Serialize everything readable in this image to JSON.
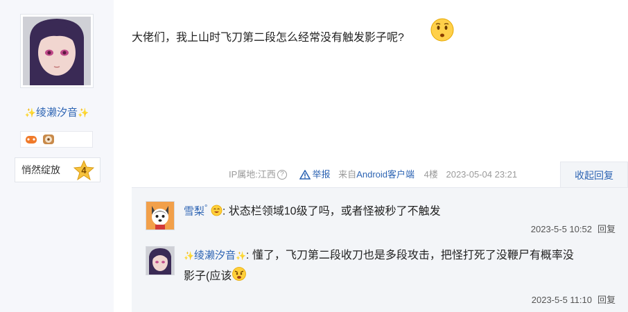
{
  "user": {
    "name": "绫濑汐音",
    "sparkle_left": "✨",
    "sparkle_right": "✨",
    "level_name": "悄然绽放",
    "level_number": "4"
  },
  "post": {
    "content": "大佬们，我上山时飞刀第二段怎么经常没有触发影子呢?",
    "meta": {
      "ip_label": "IP属地:江西",
      "help_icon": "?",
      "report_label": "举报",
      "source_prefix": "来自",
      "source_link": "Android客户端",
      "floor": "4楼",
      "timestamp": "2023-05-04 23:21"
    },
    "collapse_label": "收起回复"
  },
  "replies": [
    {
      "author": "雪梨",
      "author_suffix": "°",
      "text": ": 状态栏领域10级了吗，或者怪被秒了不触发",
      "time": "2023-5-5 10:52",
      "reply_label": "回复"
    },
    {
      "author": "绫濑汐音",
      "author_sparkle_left": "✨",
      "author_sparkle_right": "✨",
      "text_line1": ": 懂了，飞刀第二段收刀也是多段攻击，把怪打死了没鞭尸有概率没",
      "text_line2": "影子(应该",
      "time": "2023-5-5 11:10",
      "reply_label": "回复"
    }
  ],
  "colors": {
    "link_blue": "#2d64b3",
    "meta_gray": "#9a9a9a",
    "reply_bg": "#f3f5f8",
    "sidebar_bg": "#f6f7fb"
  }
}
